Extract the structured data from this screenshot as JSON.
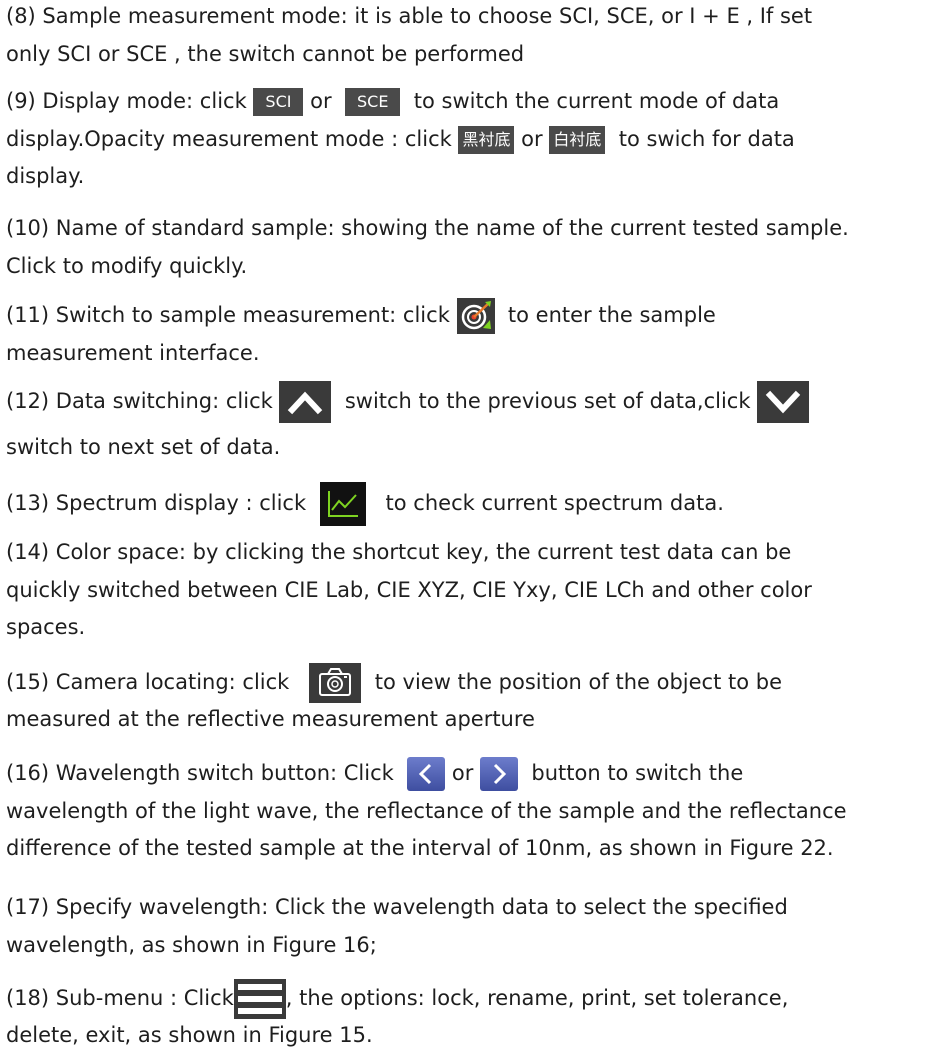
{
  "items": {
    "i8": {
      "l1": "(8) Sample measurement mode:  it is able to choose SCI, SCE, or I + E , If set",
      "l2": "only SCI or SCE , the switch cannot be performed"
    },
    "i9": {
      "a": "(9) Display mode: click ",
      "btn_sci": "SCI",
      "or1": " or ",
      "btn_sce": "SCE",
      "b": "to switch the current mode of data",
      "c": "display.Opacity measurement mode : click ",
      "btn_black": "黑衬底",
      "or2": " or ",
      "btn_white": "白衬底",
      "d": " to swich for data",
      "e": "display."
    },
    "i10": {
      "l1": "(10) Name of standard sample: showing the name of the current tested sample.",
      "l2": "Click to modify quickly."
    },
    "i11": {
      "a": "(11) Switch to sample measurement: click ",
      "b": " to enter the sample",
      "l2": "measurement interface."
    },
    "i12": {
      "a": "(12) Data switching: click ",
      "b": " switch to the previous set of data,click ",
      "l2": "switch to next set of data."
    },
    "i13": {
      "a": "(13) Spectrum display : click ",
      "b": " to check current spectrum data."
    },
    "i14": {
      "l1": "(14) Color space: by clicking the shortcut key, the current test data can be",
      "l2": "quickly switched between CIE Lab, CIE XYZ, CIE Yxy, CIE LCh and other color",
      "l3": "spaces."
    },
    "i15": {
      "a": "(15) Camera locating: click ",
      "b": " to view the position of the object to be",
      "l2": "measured at the reflective measurement aperture"
    },
    "i16": {
      "a": "(16) Wavelength switch button: Click ",
      "or": " or ",
      "b": " button to switch the",
      "l2": "wavelength of the light wave, the reflectance of the sample and the reflectance",
      "l3": "difference of the tested sample at the interval of 10nm, as shown in Figure 22."
    },
    "i17": {
      "l1": "(17) Specify wavelength: Click the wavelength data to select the specified",
      "l2": "wavelength, as shown in Figure 16;"
    },
    "i18": {
      "a": "(18) Sub-menu : Click",
      "b": ", the options: lock, rename, print, set tolerance,",
      "l2": "delete, exit, as shown in Figure 15."
    }
  },
  "icons": {
    "sample_measure": "target-icon",
    "prev": "chevron-up-icon",
    "next": "chevron-down-icon",
    "spectrum": "spectrum-chart-icon",
    "camera": "camera-icon",
    "wave_prev": "chevron-left-icon",
    "wave_next": "chevron-right-icon",
    "menu": "hamburger-menu-icon"
  },
  "colors": {
    "text": "#1e1e1e",
    "chip": "#4a4a4a",
    "spectrum_green": "#7ed321",
    "wave_button": "#4f5fb0"
  }
}
